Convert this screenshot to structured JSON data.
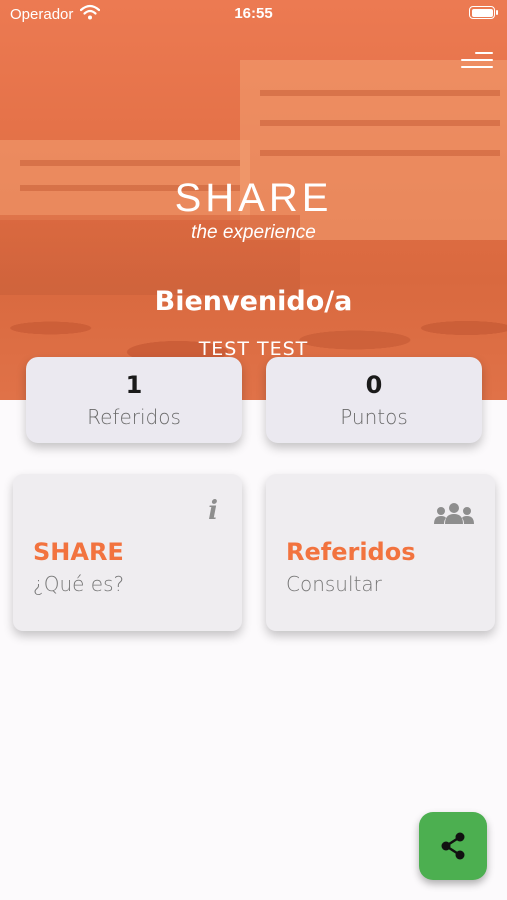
{
  "status_bar": {
    "carrier": "Operador",
    "time": "16:55"
  },
  "header": {
    "brand": "SHARE",
    "tagline": "the experience",
    "welcome": "Bienvenido/a",
    "user_name": "TEST TEST"
  },
  "stats": [
    {
      "value": "1",
      "label": "Referidos"
    },
    {
      "value": "0",
      "label": "Puntos"
    }
  ],
  "cards": [
    {
      "title": "SHARE",
      "subtitle": "¿Qué es?",
      "icon": "info-icon"
    },
    {
      "title": "Referidos",
      "subtitle": "Consultar",
      "icon": "group-icon"
    }
  ],
  "fab": {
    "icon": "share-icon"
  },
  "colors": {
    "accent": "#f2733f",
    "hero_overlay": "#e26f45",
    "fab": "#4caf50",
    "card_bg": "#efedf0"
  }
}
